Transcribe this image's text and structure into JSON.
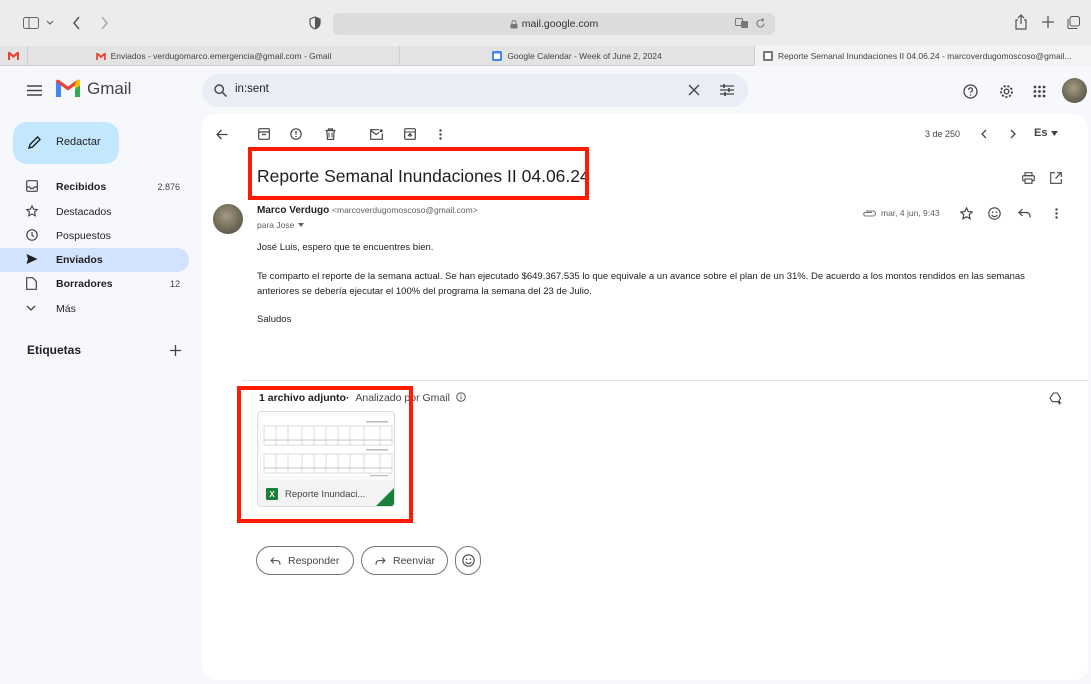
{
  "browser": {
    "url": "mail.google.com",
    "tabs": [
      {
        "label": "Enviados - verdugomarco.emergencia@gmail.com - Gmail"
      },
      {
        "label": "Google Calendar - Week of June 2, 2024"
      },
      {
        "label": "Reporte Semanal Inundaciones II 04.06.24 - marcoverdugomoscoso@gmail..."
      }
    ]
  },
  "header": {
    "brand": "Gmail",
    "search_query": "in:sent"
  },
  "sidebar": {
    "compose_label": "Redactar",
    "items": [
      {
        "label": "Recibidos",
        "count": "2.876"
      },
      {
        "label": "Destacados",
        "count": ""
      },
      {
        "label": "Pospuestos",
        "count": ""
      },
      {
        "label": "Enviados",
        "count": ""
      },
      {
        "label": "Borradores",
        "count": "12"
      },
      {
        "label": "Más",
        "count": ""
      }
    ],
    "labels_heading": "Etiquetas"
  },
  "email": {
    "pager": "3 de 250",
    "lang": "Es",
    "subject": "Reporte Semanal Inundaciones II 04.06.24",
    "sender_name": "Marco Verdugo",
    "sender_email": "<marcoverdugomoscoso@gmail.com>",
    "to": "para Jose",
    "date": "mar, 4 jun, 9:43",
    "body": [
      "José Luis, espero que te encuentres bien.",
      "Te comparto el reporte de la semana actual. Se han ejecutado $649.367.535 lo que equivale a un avance sobre el plan de un 31%. De acuerdo a los montos rendidos en las semanas anteriores se debería ejecutar el 100% del programa la semana del 23 de Julio.",
      "Saludos"
    ],
    "attachments_heading": "1 archivo adjunto",
    "scan_note": "Analizado por Gmail",
    "attachment_name": "Reporte Inundaci...",
    "reply_label": "Responder",
    "forward_label": "Reenviar"
  },
  "colors": {
    "highlight": "#ff1a00",
    "compose_bg": "#c2e7ff",
    "selected_nav": "#d3e3fd"
  }
}
